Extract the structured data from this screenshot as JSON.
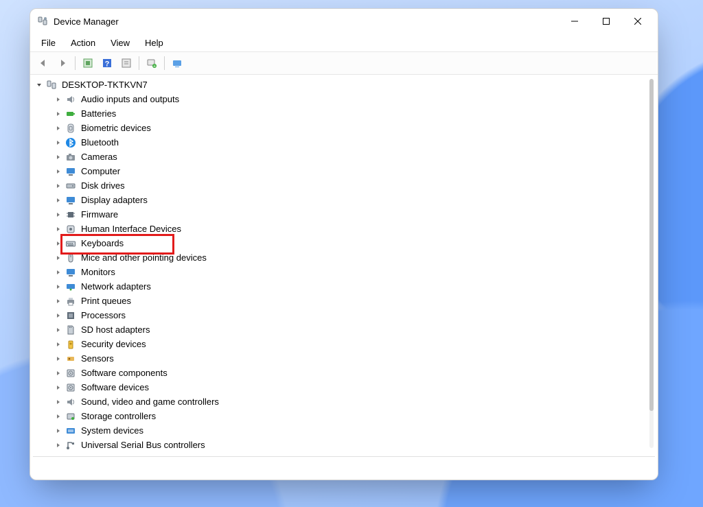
{
  "window": {
    "title": "Device Manager"
  },
  "menu": {
    "file": "File",
    "action": "Action",
    "view": "View",
    "help": "Help"
  },
  "tree": {
    "root": {
      "label": "DESKTOP-TKTKVN7",
      "expanded": true
    },
    "items": [
      {
        "label": "Audio inputs and outputs",
        "icon": "speaker"
      },
      {
        "label": "Batteries",
        "icon": "battery"
      },
      {
        "label": "Biometric devices",
        "icon": "fingerprint"
      },
      {
        "label": "Bluetooth",
        "icon": "bluetooth"
      },
      {
        "label": "Cameras",
        "icon": "camera"
      },
      {
        "label": "Computer",
        "icon": "monitor"
      },
      {
        "label": "Disk drives",
        "icon": "disk"
      },
      {
        "label": "Display adapters",
        "icon": "monitor"
      },
      {
        "label": "Firmware",
        "icon": "chip"
      },
      {
        "label": "Human Interface Devices",
        "icon": "hid"
      },
      {
        "label": "Keyboards",
        "icon": "keyboard",
        "highlight": true
      },
      {
        "label": "Mice and other pointing devices",
        "icon": "mouse"
      },
      {
        "label": "Monitors",
        "icon": "monitor"
      },
      {
        "label": "Network adapters",
        "icon": "network"
      },
      {
        "label": "Print queues",
        "icon": "printer"
      },
      {
        "label": "Processors",
        "icon": "cpu"
      },
      {
        "label": "SD host adapters",
        "icon": "sd"
      },
      {
        "label": "Security devices",
        "icon": "security"
      },
      {
        "label": "Sensors",
        "icon": "sensor"
      },
      {
        "label": "Software components",
        "icon": "software"
      },
      {
        "label": "Software devices",
        "icon": "software"
      },
      {
        "label": "Sound, video and game controllers",
        "icon": "speaker"
      },
      {
        "label": "Storage controllers",
        "icon": "storage"
      },
      {
        "label": "System devices",
        "icon": "system"
      },
      {
        "label": "Universal Serial Bus controllers",
        "icon": "usb"
      }
    ]
  },
  "highlight_color": "#e21b1b"
}
